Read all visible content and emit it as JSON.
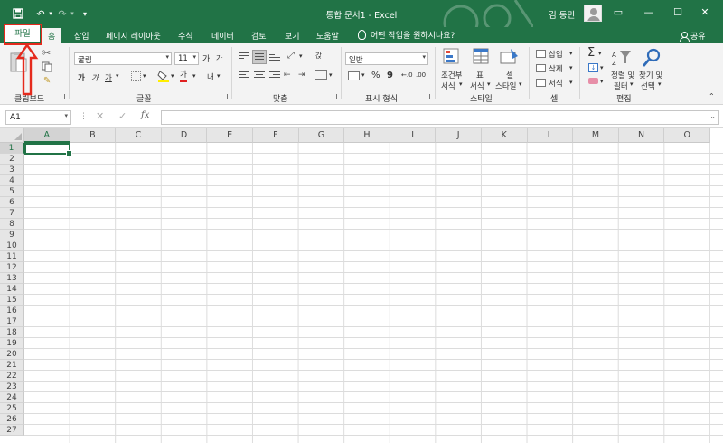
{
  "titlebar": {
    "title": "통합 문서1  -  Excel",
    "user": "김 동민",
    "qat": {
      "save_icon": "save-icon",
      "undo": "↶",
      "redo": "↷",
      "customize": "▾"
    },
    "window": {
      "ribbon_display": "▭",
      "minimize": "—",
      "maximize": "☐",
      "close": "✕"
    }
  },
  "tabs": [
    "파일",
    "홈",
    "삽입",
    "페이지 레이아웃",
    "수식",
    "데이터",
    "검토",
    "보기",
    "도움말"
  ],
  "active_tab": "홈",
  "tell_me": "어떤 작업을 원하시나요?",
  "share": "공유",
  "highlight": {
    "label": "파일",
    "color": "#e52a1d"
  },
  "ribbon": {
    "clipboard": {
      "label": "클립보드"
    },
    "font": {
      "label": "글꼴",
      "font_name": "굴림",
      "font_size": "11",
      "grow": "가",
      "shrink": "가",
      "bold": "가",
      "italic": "가",
      "underline": "가",
      "font_color": "가",
      "phonetic": "내",
      "dd": "▾"
    },
    "alignment": {
      "label": "맞춤",
      "wrap": "갅"
    },
    "number": {
      "label": "표시 형식",
      "format": "일반",
      "percent": "%",
      "comma": "9",
      "inc": "←.0",
      "dec": ".00"
    },
    "styles": {
      "label": "스타일",
      "conditional_1": "조건부",
      "conditional_2": "서식",
      "table_1": "표",
      "table_2": "서식",
      "cell_1": "셀",
      "cell_2": "스타일"
    },
    "cells": {
      "label": "셀",
      "insert": "삽입",
      "delete": "삭제",
      "format": "서식"
    },
    "editing": {
      "label": "편집",
      "sort_1": "정렬 및",
      "sort_2": "필터",
      "find_1": "찾기 및",
      "find_2": "선택",
      "sum": "Σ"
    }
  },
  "formula_bar": {
    "name_box": "A1",
    "cancel": "✕",
    "enter": "✓",
    "fx": "fx"
  },
  "grid": {
    "columns": [
      "A",
      "B",
      "C",
      "D",
      "E",
      "F",
      "G",
      "H",
      "I",
      "J",
      "K",
      "L",
      "M",
      "N",
      "O"
    ],
    "rows": [
      "1",
      "2",
      "3",
      "4",
      "5",
      "6",
      "7",
      "8",
      "9",
      "10",
      "11",
      "12",
      "13",
      "14",
      "15",
      "16",
      "17",
      "18",
      "19",
      "20",
      "21",
      "22",
      "23",
      "24",
      "25",
      "26",
      "27"
    ],
    "selected_cell": "A1"
  },
  "colors": {
    "brand": "#217346",
    "annotation": "#e52a1d"
  }
}
